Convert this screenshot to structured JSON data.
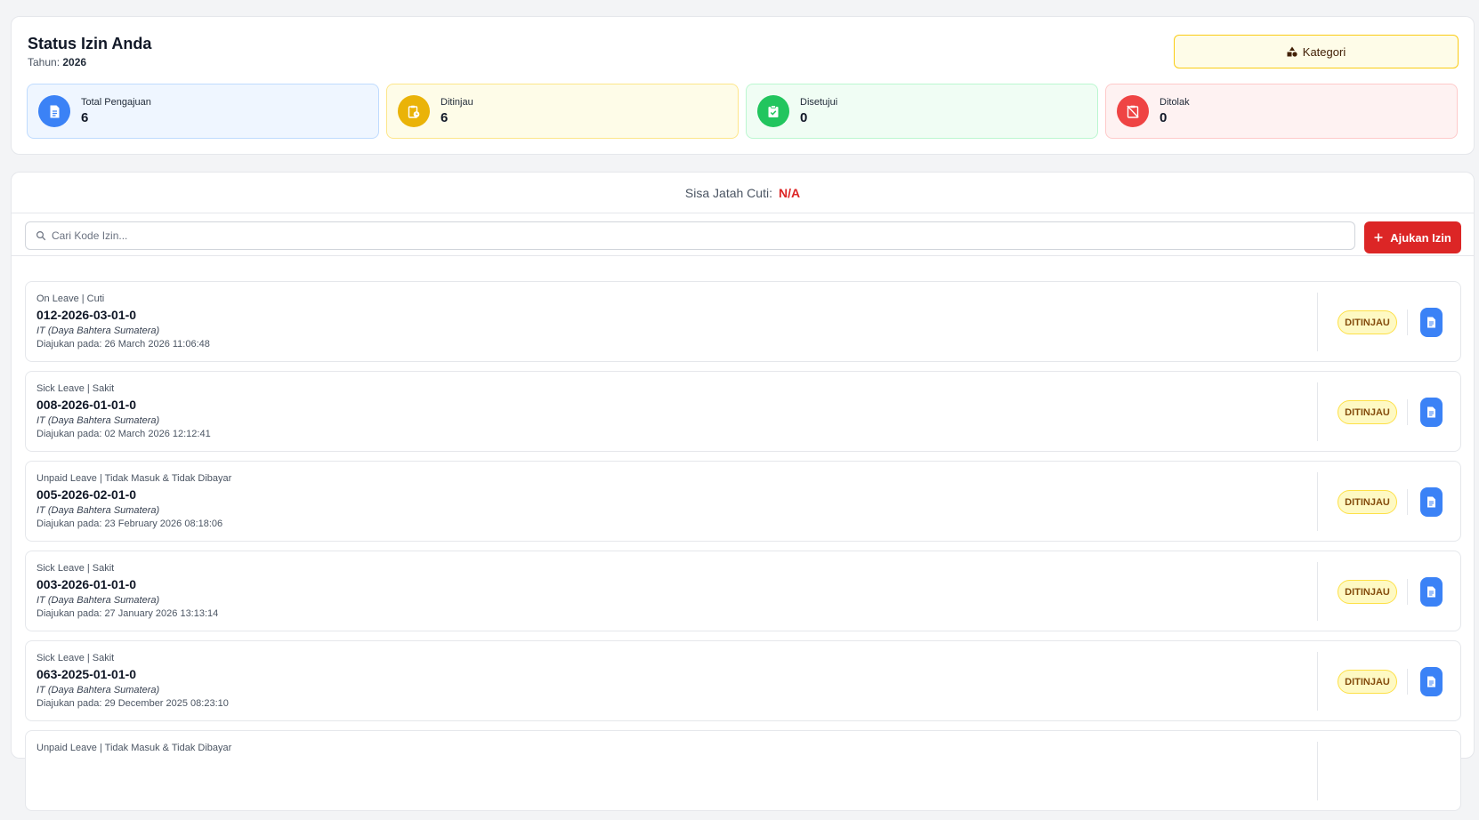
{
  "header": {
    "title": "Status Izin Anda",
    "year_label": "Tahun:",
    "year": "2026",
    "kategori_label": "Kategori"
  },
  "stats": [
    {
      "label": "Total Pengajuan",
      "value": "6",
      "icon": "document-icon",
      "color": "#3b82f6",
      "bg": "#eff6ff",
      "border": "#bfdbfe"
    },
    {
      "label": "Ditinjau",
      "value": "6",
      "icon": "clipboard-clock-icon",
      "color": "#eab308",
      "bg": "#fefce8",
      "border": "#fde68a"
    },
    {
      "label": "Disetujui",
      "value": "0",
      "icon": "clipboard-check-icon",
      "color": "#22c55e",
      "bg": "#f0fdf4",
      "border": "#bbf7d0"
    },
    {
      "label": "Ditolak",
      "value": "0",
      "icon": "clipboard-x-icon",
      "color": "#ef4444",
      "bg": "#fef2f2",
      "border": "#fecaca"
    }
  ],
  "leave_balance": {
    "label": "Sisa Jatah Cuti:",
    "value": "N/A"
  },
  "search": {
    "placeholder": "Cari Kode Izin..."
  },
  "submit_button": {
    "label": "Ajukan Izin"
  },
  "items": [
    {
      "type": "On Leave | Cuti",
      "code": "012-2026-03-01-0",
      "dept": "IT (Daya Bahtera Sumatera)",
      "date": "Diajukan pada: 26 March 2026 11:06:48",
      "status": "DITINJAU"
    },
    {
      "type": "Sick Leave | Sakit",
      "code": "008-2026-01-01-0",
      "dept": "IT (Daya Bahtera Sumatera)",
      "date": "Diajukan pada: 02 March 2026 12:12:41",
      "status": "DITINJAU"
    },
    {
      "type": "Unpaid Leave | Tidak Masuk & Tidak Dibayar",
      "code": "005-2026-02-01-0",
      "dept": "IT (Daya Bahtera Sumatera)",
      "date": "Diajukan pada: 23 February 2026 08:18:06",
      "status": "DITINJAU"
    },
    {
      "type": "Sick Leave | Sakit",
      "code": "003-2026-01-01-0",
      "dept": "IT (Daya Bahtera Sumatera)",
      "date": "Diajukan pada: 27 January 2026 13:13:14",
      "status": "DITINJAU"
    },
    {
      "type": "Sick Leave | Sakit",
      "code": "063-2025-01-01-0",
      "dept": "IT (Daya Bahtera Sumatera)",
      "date": "Diajukan pada: 29 December 2025 08:23:10",
      "status": "DITINJAU"
    },
    {
      "type": "Unpaid Leave | Tidak Masuk & Tidak Dibayar",
      "code": "",
      "dept": "",
      "date": "",
      "status": ""
    }
  ]
}
